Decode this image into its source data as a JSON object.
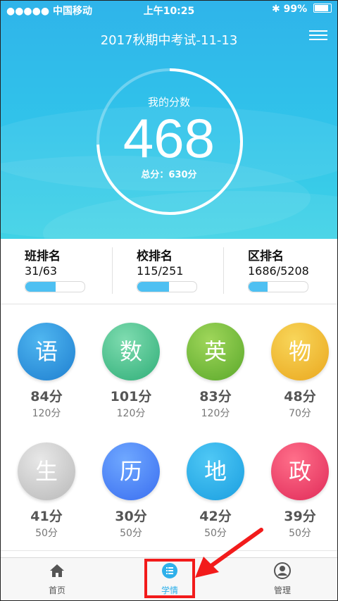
{
  "status_bar": {
    "carrier": "●●●●● 中国移动",
    "time": "上午10:25",
    "battery": "99%"
  },
  "header": {
    "title": "2017秋期中考试-11-13"
  },
  "score": {
    "label": "我的分数",
    "value": "468",
    "total_label": "总分：630分",
    "ratio": 0.743
  },
  "ranks": [
    {
      "name": "班排名",
      "value": "31/63",
      "fraction": 0.51
    },
    {
      "name": "校排名",
      "value": "115/251",
      "fraction": 0.54
    },
    {
      "name": "区排名",
      "value": "1686/5208",
      "fraction": 0.32
    }
  ],
  "subjects": [
    {
      "char": "语",
      "score": "84分",
      "full": "120分",
      "color_top": "#4fb6f0",
      "color_bottom": "#1f7fd0"
    },
    {
      "char": "数",
      "score": "101分",
      "full": "120分",
      "color_top": "#7fdcb0",
      "color_bottom": "#2fae78"
    },
    {
      "char": "英",
      "score": "83分",
      "full": "120分",
      "color_top": "#9fd65a",
      "color_bottom": "#5aa82a"
    },
    {
      "char": "物",
      "score": "48分",
      "full": "70分",
      "color_top": "#f8d65a",
      "color_bottom": "#eaa71e"
    },
    {
      "char": "生",
      "score": "41分",
      "full": "50分",
      "color_top": "#e8e8e8",
      "color_bottom": "#b8b8b8"
    },
    {
      "char": "历",
      "score": "30分",
      "full": "50分",
      "color_top": "#6fa8ff",
      "color_bottom": "#3a6ef0"
    },
    {
      "char": "地",
      "score": "42分",
      "full": "50分",
      "color_top": "#4fc8f5",
      "color_bottom": "#1a9ee0"
    },
    {
      "char": "政",
      "score": "39分",
      "full": "50分",
      "color_top": "#ff6f8a",
      "color_bottom": "#e02a58"
    }
  ],
  "tabbar": {
    "home": "首页",
    "study": "学情",
    "manage": "管理"
  },
  "colors": {
    "accent": "#2fb0ea",
    "highlight": "#f21b1b"
  }
}
